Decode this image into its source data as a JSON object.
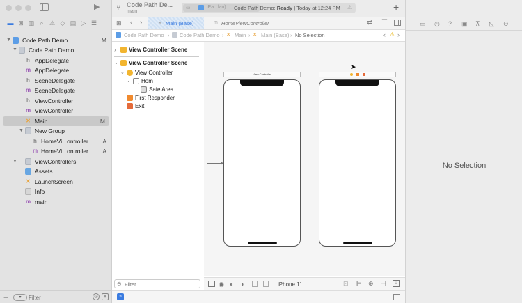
{
  "toolbar": {
    "project_title": "Code Path De...",
    "branch": "main",
    "scheme_target": "iPa...lan)",
    "status_text": "Code Path Demo: ",
    "status_bold": "Ready",
    "status_time": " | Today at 12:24 PM"
  },
  "navigator": {
    "items": [
      {
        "label": "Code Path Demo",
        "status": "M"
      },
      {
        "label": "Code Path Demo",
        "status": ""
      },
      {
        "label": "AppDelegate",
        "status": ""
      },
      {
        "label": "AppDelegate",
        "status": ""
      },
      {
        "label": "SceneDelegate",
        "status": ""
      },
      {
        "label": "SceneDelegate",
        "status": ""
      },
      {
        "label": "ViewController",
        "status": ""
      },
      {
        "label": "ViewController",
        "status": ""
      },
      {
        "label": "Main",
        "status": "M"
      },
      {
        "label": "New Group",
        "status": ""
      },
      {
        "label": "HomeVi...ontroller",
        "status": "A"
      },
      {
        "label": "HomeVi...ontroller",
        "status": "A"
      },
      {
        "label": "ViewControllers",
        "status": ""
      },
      {
        "label": "Assets",
        "status": ""
      },
      {
        "label": "LaunchScreen",
        "status": ""
      },
      {
        "label": "Info",
        "status": ""
      },
      {
        "label": "main",
        "status": ""
      }
    ],
    "filter_placeholder": "Filter"
  },
  "tabs": {
    "active": "Main (Base)",
    "inactive": "HomeViewController"
  },
  "breadcrumb": [
    "Code Path Demo",
    "Code Path Demo",
    "Main",
    "Main (Base)",
    "No Selection"
  ],
  "outline": {
    "scene1": "View Controller Scene",
    "scene2": "View Controller Scene",
    "view_controller": "View Controller",
    "hom": "Hom",
    "safe_area": "Safe Area",
    "first_responder": "First Responder",
    "exit": "Exit",
    "filter_placeholder": "Filter"
  },
  "canvas": {
    "vc_label": "View Controller",
    "device": "iPhone 11"
  },
  "inspector": {
    "empty_text": "No Selection"
  }
}
